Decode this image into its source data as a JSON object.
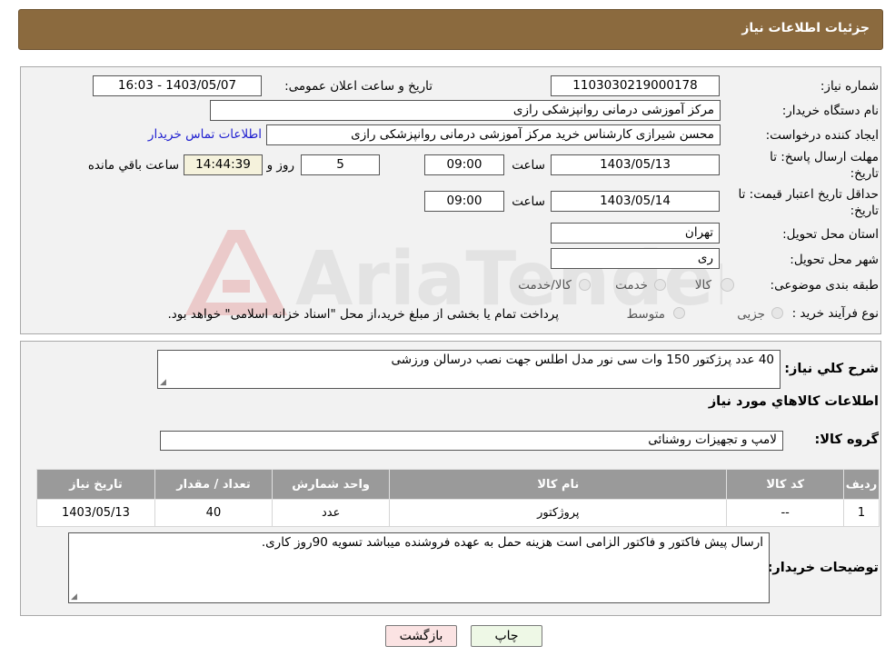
{
  "header": {
    "title": "جزئیات اطلاعات نیاز"
  },
  "watermark": {
    "text": "AriaTender.neT"
  },
  "form": {
    "need_number": {
      "label": "شماره نیاز:",
      "value": "1103030219000178"
    },
    "announce": {
      "label": "تاریخ و ساعت اعلان عمومی:",
      "value": "1403/05/07 - 16:03"
    },
    "buyer_org": {
      "label": "نام دستگاه خریدار:",
      "value": "مرکز آموزشی درمانی روانپزشکی رازی"
    },
    "requester": {
      "label": "ایجاد کننده درخواست:",
      "value": "محسن شیرازی کارشناس خرید مرکز آموزشی درمانی روانپزشکی رازی"
    },
    "contact_link": "اطلاعات تماس خریدار",
    "reply_deadline": {
      "label_line1": "مهلت ارسال پاسخ: تا",
      "label_line2": "تاریخ:",
      "date": "1403/05/13",
      "time_label": "ساعت",
      "time": "09:00",
      "days": "5",
      "days_label": "روز و",
      "remaining": "14:44:39",
      "remaining_label": "ساعت باقي مانده"
    },
    "price_validity": {
      "label_line1": "حداقل تاریخ اعتبار قیمت: تا",
      "label_line2": "تاریخ:",
      "date": "1403/05/14",
      "time_label": "ساعت",
      "time": "09:00"
    },
    "province": {
      "label": "استان محل تحویل:",
      "value": "تهران"
    },
    "city": {
      "label": "شهر محل تحویل:",
      "value": "ری"
    },
    "category": {
      "label": "طبقه بندی موضوعی:",
      "options": [
        "کالا",
        "خدمت",
        "کالا/خدمت"
      ]
    },
    "process": {
      "label": "نوع فرآیند خرید :",
      "options": [
        "جزیی",
        "متوسط"
      ],
      "note": "پرداخت تمام یا بخشی از مبلغ خرید،از محل \"اسناد خزانه اسلامی\" خواهد بود."
    }
  },
  "details": {
    "summary_label": "شرح کلي نياز:",
    "summary_value": "40 عدد پرژکتور 150 وات سی نور مدل اطلس جهت نصب درسالن ورزشی",
    "goods_info_title": "اطلاعات کالاهاي مورد نياز",
    "goods_group_label": "گروه کالا:",
    "goods_group_value": "لامپ و تجهیزات روشنائی",
    "table": {
      "headers": [
        "ردیف",
        "کد کالا",
        "نام کالا",
        "واحد شمارش",
        "تعداد / مقدار",
        "تاریخ نیاز"
      ],
      "rows": [
        [
          "1",
          "--",
          "پروژکتور",
          "عدد",
          "40",
          "1403/05/13"
        ]
      ]
    },
    "buyer_notes_label": "توضیحات خریدار:",
    "buyer_notes_value": "ارسال پیش فاکتور و فاکتور الزامی است هزینه حمل به عهده فروشنده میباشد تسویه 90روز کاری."
  },
  "buttons": {
    "print": "چاپ",
    "back": "بازگشت"
  }
}
